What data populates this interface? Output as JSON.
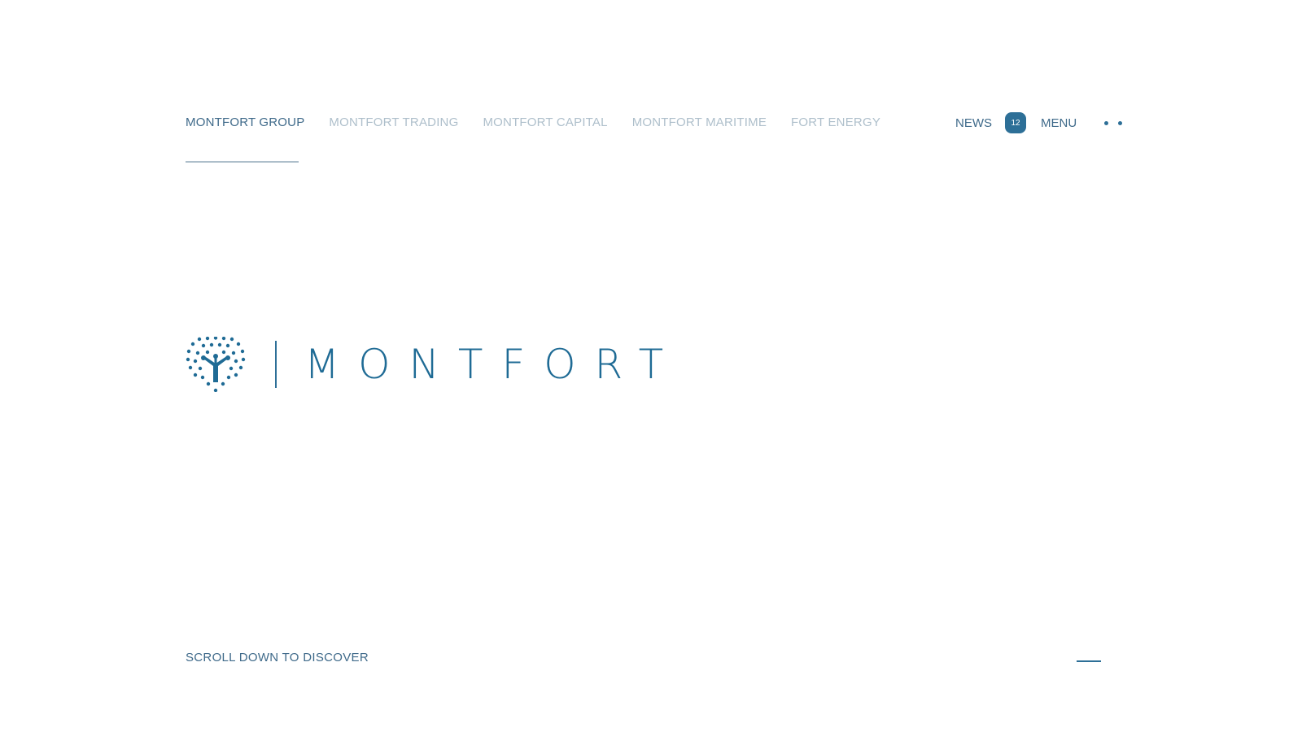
{
  "nav": {
    "items": [
      {
        "label": "MONTFORT GROUP"
      },
      {
        "label": "MONTFORT TRADING"
      },
      {
        "label": "MONTFORT CAPITAL"
      },
      {
        "label": "MONTFORT MARITIME"
      },
      {
        "label": "FORT ENERGY"
      }
    ],
    "active_index": 0
  },
  "header_right": {
    "news_label": "NEWS",
    "news_count": "12",
    "menu_label": "MENU"
  },
  "logo": {
    "wordmark": "MONTFORT"
  },
  "footer": {
    "scroll_text": "SCROLL DOWN TO DISCOVER"
  },
  "colors": {
    "brand": "#1f6b95",
    "active_nav": "#3f6a8a",
    "inactive_nav": "#aebfcb",
    "background": "#ffffff"
  }
}
